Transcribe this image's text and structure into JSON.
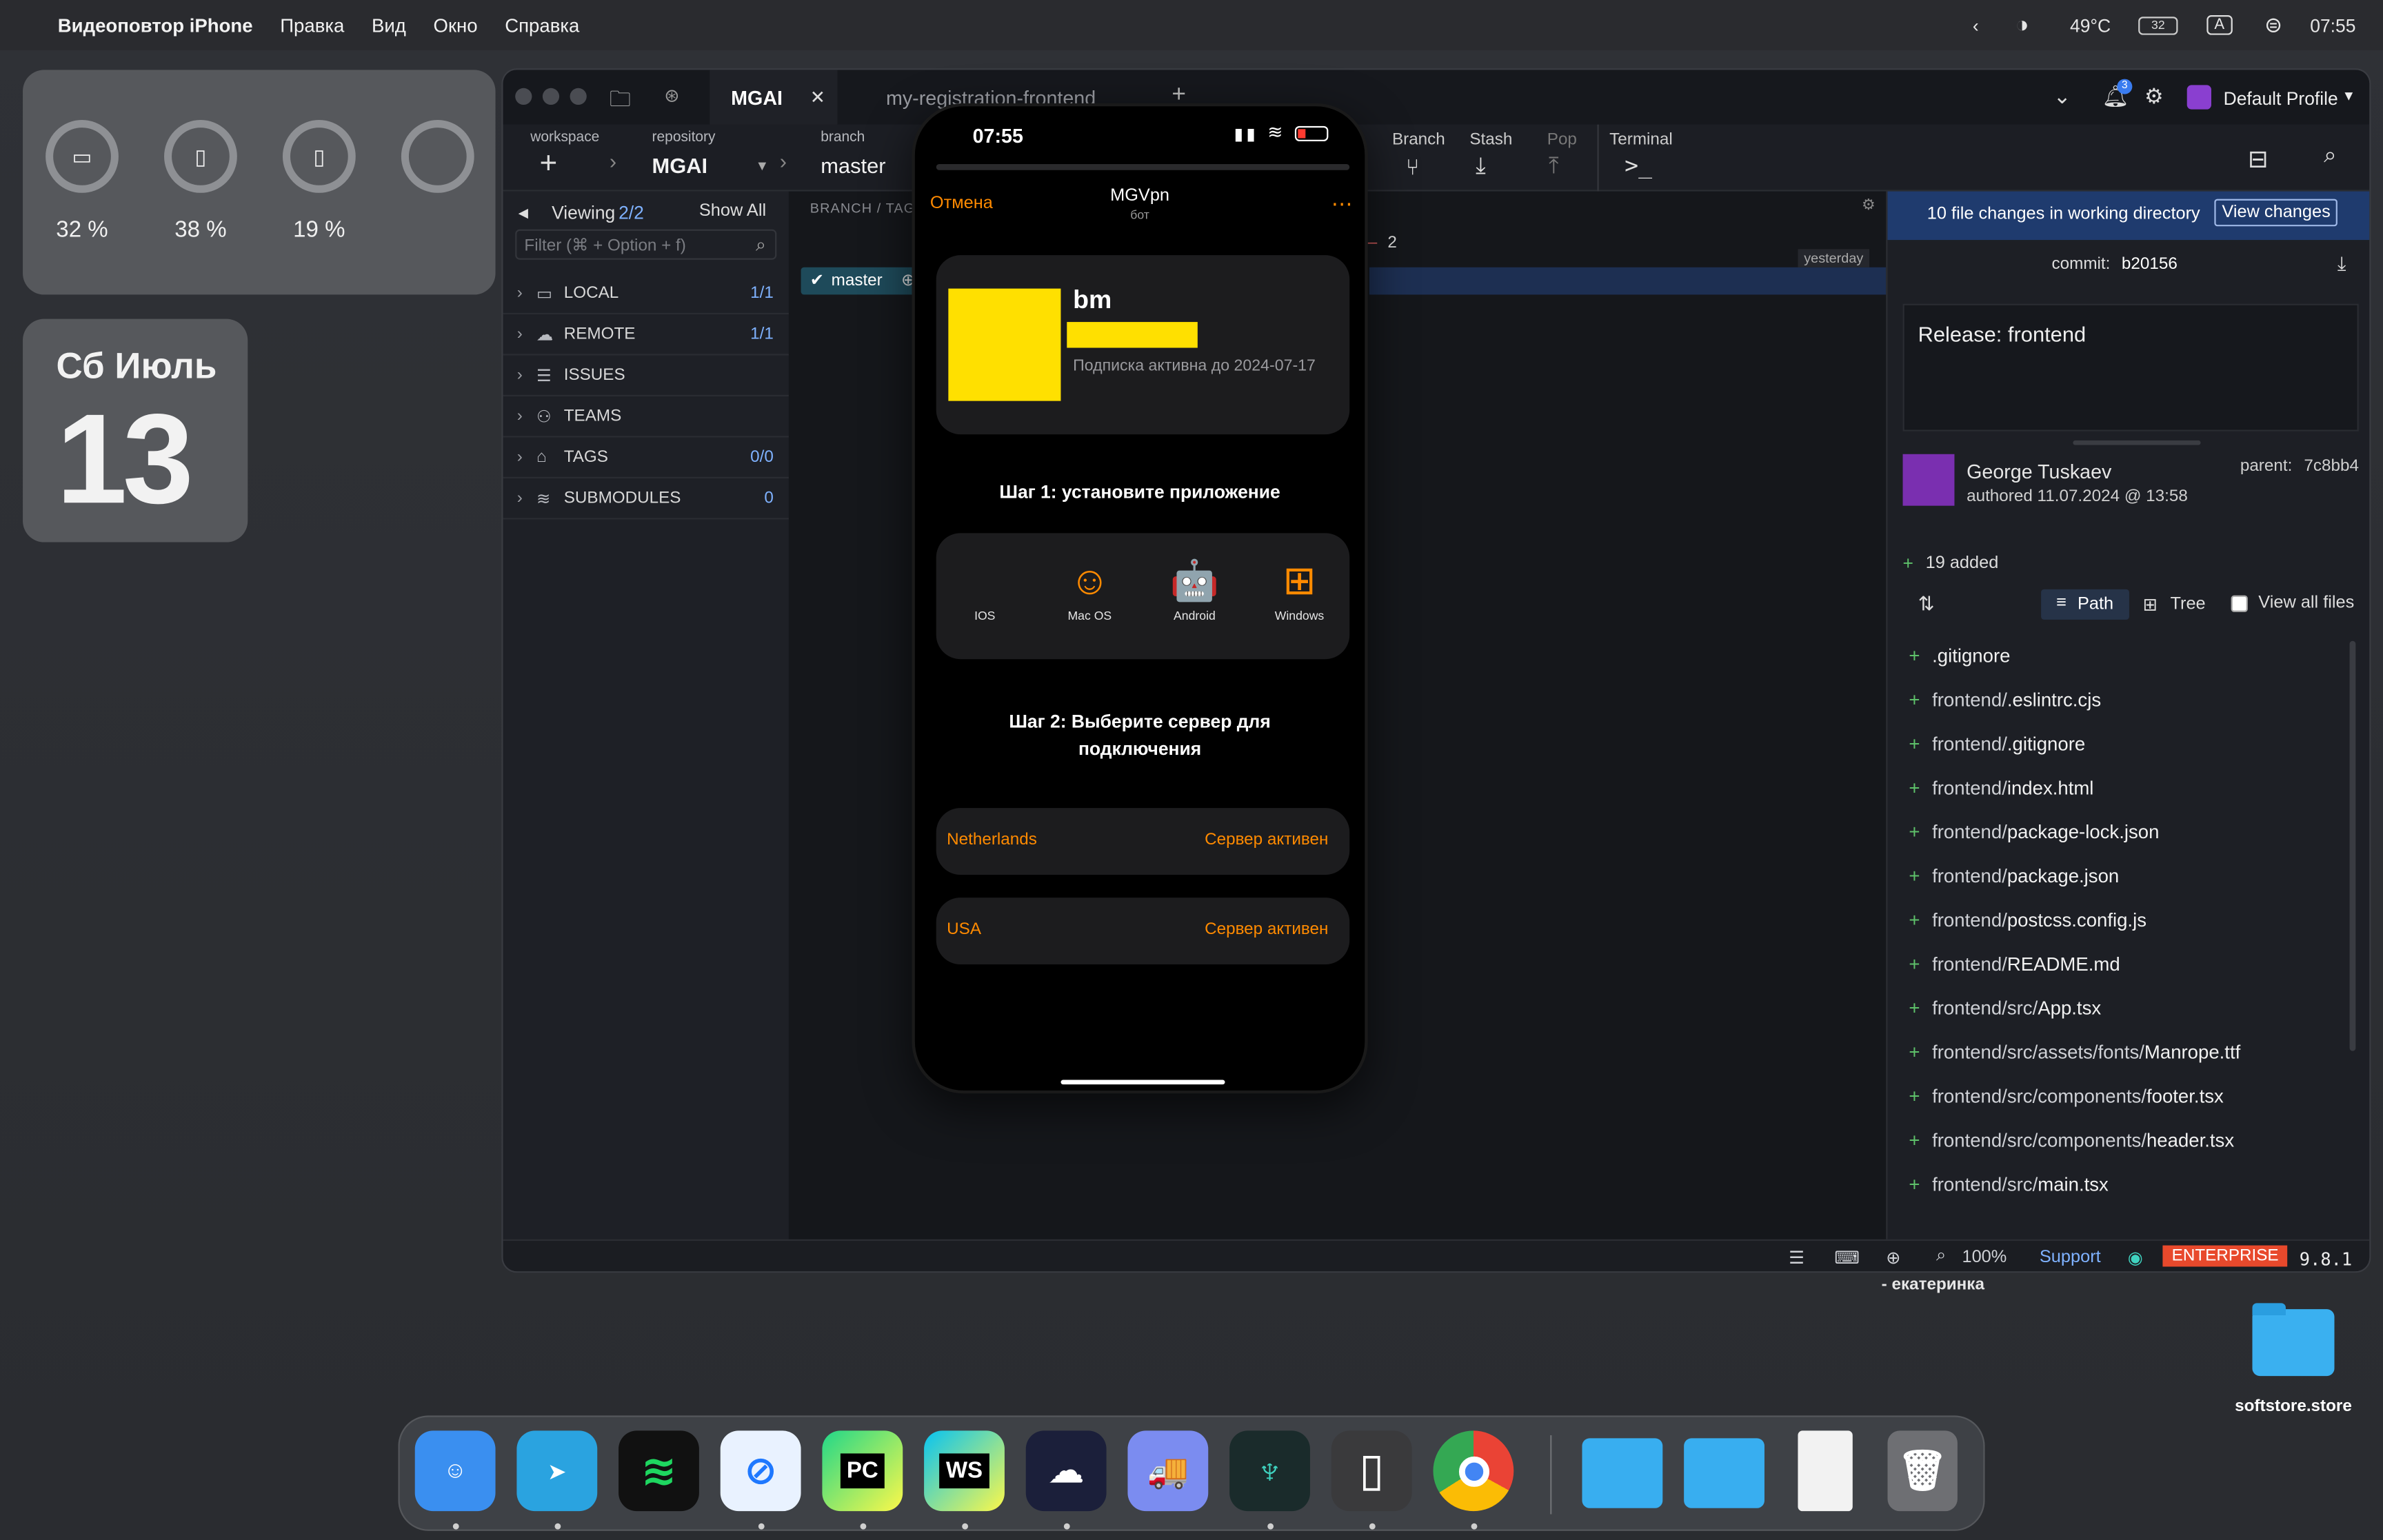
{
  "menubar": {
    "app": "Видеоповтор iPhone",
    "items": [
      "Правка",
      "Вид",
      "Окно",
      "Справка"
    ],
    "temp": "49°C",
    "battery": "32",
    "input": "A",
    "time": "07:55"
  },
  "battery_widget": {
    "values": [
      "32 %",
      "38 %",
      "19 %"
    ],
    "icons": [
      "laptop-icon",
      "iphone-icon",
      "iphone-icon",
      "empty-ring-icon"
    ]
  },
  "calendar_widget": {
    "weekday_month": "Сб Июль",
    "day": "13"
  },
  "gitkraken": {
    "tabs": [
      {
        "label": "MGAI"
      },
      {
        "label": "my-registration-frontend"
      }
    ],
    "profile": "Default Profile",
    "notif_count": "3",
    "toolbar": {
      "workspace_label": "workspace",
      "repository_label": "repository",
      "repository_value": "MGAI",
      "branch_label": "branch",
      "branch_value": "master",
      "buttons": [
        "Branch",
        "Stash",
        "Pop",
        "Terminal"
      ]
    },
    "left": {
      "viewing": "Viewing",
      "viewing_count": "2/2",
      "show_all": "Show All",
      "filter_placeholder": "Filter (⌘ + Option + f)",
      "sections": [
        {
          "label": "LOCAL",
          "count": "1/1"
        },
        {
          "label": "REMOTE",
          "count": "1/1"
        },
        {
          "label": "ISSUES",
          "count": ""
        },
        {
          "label": "TEAMS",
          "count": ""
        },
        {
          "label": "TAGS",
          "count": "0/0"
        },
        {
          "label": "SUBMODULES",
          "count": "0"
        }
      ]
    },
    "graph": {
      "header": "BRANCH / TAG",
      "branch_chip": "master",
      "count": "2",
      "when": "yesterday"
    },
    "right": {
      "changes_text": "10 file changes in working directory",
      "view_changes": "View changes",
      "commit_label": "commit:",
      "commit_hash": "b20156",
      "message": "Release: frontend",
      "author": "George Tuskaev",
      "authored": "authored 11.07.2024 @ 13:58",
      "parent_label": "parent:",
      "parent_hash": "7c8bb4",
      "added": "19 added",
      "path_tab": "Path",
      "tree_tab": "Tree",
      "view_all": "View all files",
      "files": [
        {
          "dir": "",
          "name": ".gitignore"
        },
        {
          "dir": "frontend/",
          "name": ".eslintrc.cjs"
        },
        {
          "dir": "frontend/",
          "name": ".gitignore"
        },
        {
          "dir": "frontend/",
          "name": "index.html"
        },
        {
          "dir": "frontend/",
          "name": "package-lock.json"
        },
        {
          "dir": "frontend/",
          "name": "package.json"
        },
        {
          "dir": "frontend/",
          "name": "postcss.config.js"
        },
        {
          "dir": "frontend/",
          "name": "README.md"
        },
        {
          "dir": "frontend/src/",
          "name": "App.tsx"
        },
        {
          "dir": "frontend/src/assets/fonts/",
          "name": "Manrope.ttf"
        },
        {
          "dir": "frontend/src/components/",
          "name": "footer.tsx"
        },
        {
          "dir": "frontend/src/components/",
          "name": "header.tsx"
        },
        {
          "dir": "frontend/src/",
          "name": "main.tsx"
        }
      ]
    },
    "status": {
      "zoom": "100%",
      "support": "Support",
      "edition": "ENTERPRISE",
      "version": "9.8.1"
    }
  },
  "phone": {
    "time": "07:55",
    "cancel": "Отмена",
    "title": "MGVpn",
    "subtitle": "бот",
    "user_name": "bm",
    "subscription": "Подписка активна до 2024-07-17",
    "step1": "Шаг 1: установите приложение",
    "platforms": [
      {
        "icon": "apple-icon",
        "glyph": "",
        "label": "IOS"
      },
      {
        "icon": "finder-icon",
        "glyph": "☺",
        "label": "Mac OS"
      },
      {
        "icon": "android-icon",
        "glyph": "🤖",
        "label": "Android"
      },
      {
        "icon": "windows-icon",
        "glyph": "⊞",
        "label": "Windows"
      }
    ],
    "step2": "Шаг 2: Выберите сервер для подключения",
    "servers": [
      {
        "name": "Netherlands",
        "status": "Сервер активен"
      },
      {
        "name": "USA",
        "status": "Сервер активен"
      }
    ]
  },
  "desktop": {
    "caption": "- екатеринка",
    "folder_label": "softstore.store"
  },
  "dock": {
    "apps": [
      {
        "name": "finder-icon",
        "text": "☺",
        "bg": "#3a8ff0"
      },
      {
        "name": "telegram-icon",
        "text": "➤",
        "bg": "#2aa3e0"
      },
      {
        "name": "spotify-icon",
        "text": "≋",
        "bg": "#1ed760"
      },
      {
        "name": "safari-icon",
        "text": "⊘",
        "bg": "#1e90ff"
      },
      {
        "name": "pycharm-icon",
        "text": "PC",
        "bg": "#21d789"
      },
      {
        "name": "webstorm-icon",
        "text": "WS",
        "bg": "#07c3f2"
      },
      {
        "name": "cloud-terminal-icon",
        "text": "☁",
        "bg": "#1b1f3a"
      },
      {
        "name": "transmit-icon",
        "text": "🚚",
        "bg": "#7b8cf0"
      },
      {
        "name": "gitkraken-icon",
        "text": "♆",
        "bg": "#1a2b2b"
      },
      {
        "name": "iphone-mirroring-icon",
        "text": "▯",
        "bg": "#3a3a3c"
      },
      {
        "name": "chrome-icon",
        "text": "◉",
        "bg": "#ffffff"
      },
      {
        "name": "folder-icon",
        "text": "",
        "bg": "#38aef0"
      },
      {
        "name": "folder-icon",
        "text": "",
        "bg": "#38aef0"
      },
      {
        "name": "document-icon",
        "text": "",
        "bg": "#f2f2f2"
      },
      {
        "name": "trash-icon",
        "text": "🗑",
        "bg": "#6e6f73"
      }
    ]
  }
}
